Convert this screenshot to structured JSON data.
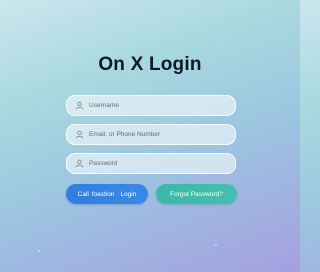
{
  "login": {
    "title": "On X Login",
    "username": {
      "placeholder": "Username",
      "icon": "user-icon"
    },
    "email_phone": {
      "placeholder": "Email, or Phone Number",
      "icon": "user-icon"
    },
    "password": {
      "placeholder": "Password",
      "icon": "user-icon"
    },
    "login_button": {
      "prefix": "Call foastion",
      "label": "Login"
    },
    "forgot_button": {
      "label": "Forgot Password?"
    }
  },
  "colors": {
    "title": "#0f1a24",
    "login_button": "#2f7ee0",
    "forgot_button": "#3cb8a6",
    "field_background": "#ffffff"
  }
}
